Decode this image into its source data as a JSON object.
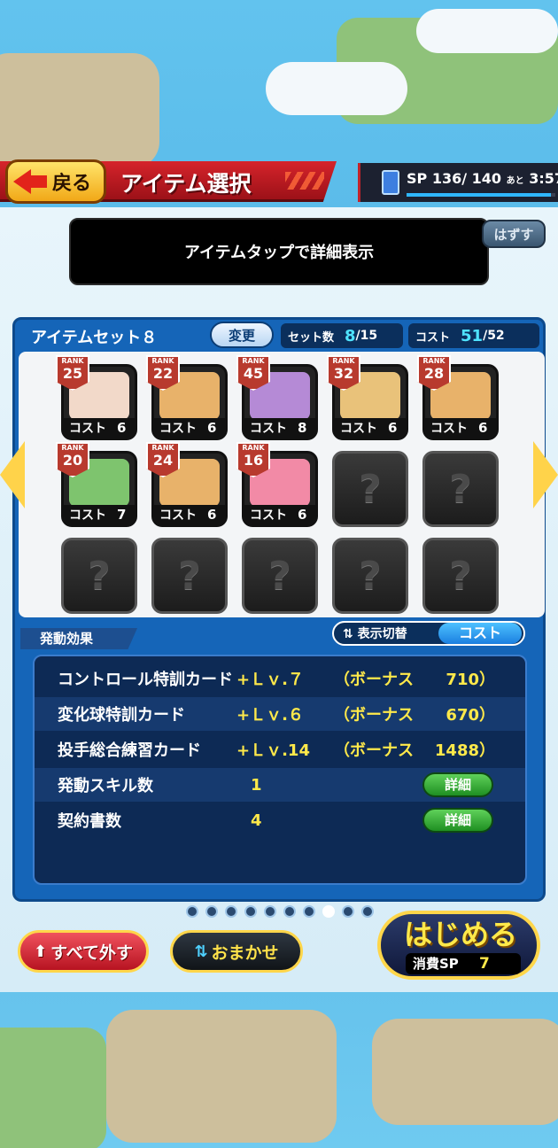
{
  "header": {
    "back_label": "戻る",
    "title": "アイテム選択",
    "sp_label": "SP",
    "sp_value": "136/ 140",
    "sp_suffix": "あと",
    "sp_timer": "3:57",
    "sp_fill_fraction": 0.971
  },
  "info_text": "アイテムタップで詳細表示",
  "remove_label": "はずす",
  "set": {
    "name": "アイテムセット８",
    "change_label": "変更",
    "count_label": "セット数",
    "count_value": "8",
    "count_max": "/15",
    "cost_label": "コスト",
    "cost_value": "51",
    "cost_max": "/52"
  },
  "item_cost_label": "コスト",
  "rank_label": "RANK",
  "items": [
    {
      "rank": "25",
      "cost": "6",
      "color": "#f2d9c9"
    },
    {
      "rank": "22",
      "cost": "6",
      "color": "#e8b26a"
    },
    {
      "rank": "45",
      "cost": "8",
      "color": "#b58ad6"
    },
    {
      "rank": "32",
      "cost": "6",
      "color": "#e9c27a"
    },
    {
      "rank": "28",
      "cost": "6",
      "color": "#e8b26a"
    },
    {
      "rank": "20",
      "cost": "7",
      "color": "#7ec46e"
    },
    {
      "rank": "24",
      "cost": "6",
      "color": "#e8b26a"
    },
    {
      "rank": "16",
      "cost": "6",
      "color": "#f28aa6"
    }
  ],
  "empty_symbol": "?",
  "effects_title": "発動効果",
  "toggle": {
    "label": "表示切替",
    "value": "コスト"
  },
  "effects": [
    {
      "name": "コントロール特訓カード",
      "lv": "+Ｌｖ.７",
      "bonus_label": "（ボーナス",
      "bonus_value": "710）"
    },
    {
      "name": "変化球特訓カード",
      "lv": "+Ｌｖ.６",
      "bonus_label": "（ボーナス",
      "bonus_value": "670）"
    },
    {
      "name": "投手総合練習カード",
      "lv": "+Ｌｖ.14",
      "bonus_label": "（ボーナス",
      "bonus_value": "1488）"
    }
  ],
  "counts": [
    {
      "name": "発動スキル数",
      "value": "1",
      "detail_label": "詳細"
    },
    {
      "name": "契約書数",
      "value": "4",
      "detail_label": "詳細"
    }
  ],
  "page_dots": {
    "total": 10,
    "active_index": 7
  },
  "buttons": {
    "remove_all": "すべて外す",
    "auto": "おまかせ",
    "start": "はじめる",
    "start_sp_label": "消費SP",
    "start_sp_value": "7"
  }
}
